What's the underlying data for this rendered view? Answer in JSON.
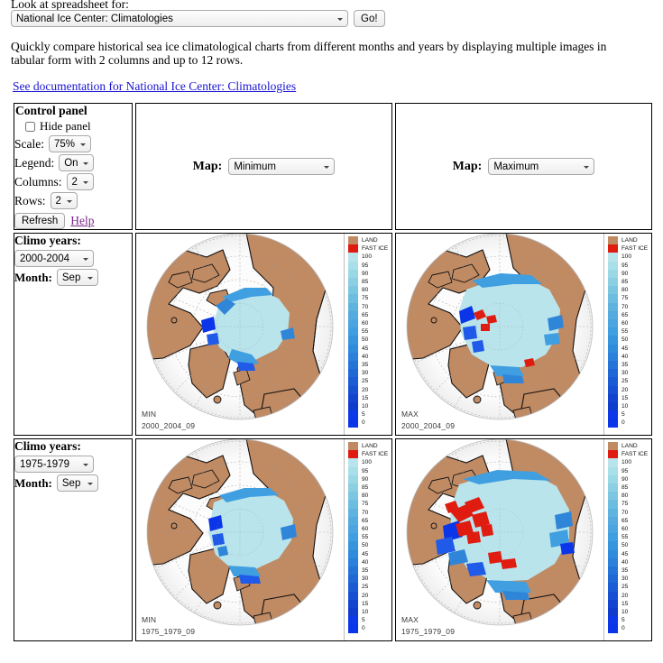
{
  "header": {
    "spreadsheet_label": "Look at spreadsheet for:",
    "dataset_selected": "National Ice Center: Climatologies",
    "go_label": "Go!",
    "description": "Quickly compare historical sea ice climatological charts from different months and years by displaying multiple images in tabular form with 2 columns and up to 12 rows.",
    "doc_link": "See documentation for National Ice Center: Climatologies"
  },
  "control_panel": {
    "title": "Control panel",
    "hide_panel_label": "Hide panel",
    "hide_panel_checked": false,
    "scale_label": "Scale:",
    "scale_value": "75%",
    "legend_label": "Legend:",
    "legend_value": "On",
    "columns_label": "Columns:",
    "columns_value": "2",
    "rows_label": "Rows:",
    "rows_value": "2",
    "refresh_label": "Refresh",
    "help_label": "Help"
  },
  "columns": [
    {
      "map_label": "Map:",
      "map_value": "Minimum"
    },
    {
      "map_label": "Map:",
      "map_value": "Maximum"
    }
  ],
  "rows": [
    {
      "climo_years_label": "Climo years:",
      "climo_years_value": "2000-2004",
      "month_label": "Month:",
      "month_value": "Sep",
      "cells": [
        {
          "tag_type": "MIN",
          "tag_id": "2000_2004_09"
        },
        {
          "tag_type": "MAX",
          "tag_id": "2000_2004_09"
        }
      ]
    },
    {
      "climo_years_label": "Climo years:",
      "climo_years_value": "1975-1979",
      "month_label": "Month:",
      "month_value": "Sep",
      "cells": [
        {
          "tag_type": "MIN",
          "tag_id": "1975_1979_09"
        },
        {
          "tag_type": "MAX",
          "tag_id": "1975_1979_09"
        }
      ]
    }
  ],
  "legend": {
    "land_label": "LAND",
    "fast_ice_label": "FAST ICE",
    "ticks": [
      "100",
      "95",
      "90",
      "85",
      "80",
      "75",
      "70",
      "65",
      "60",
      "55",
      "50",
      "45",
      "40",
      "35",
      "30",
      "25",
      "20",
      "15",
      "10",
      "5",
      "0"
    ]
  },
  "colors": {
    "land": "#c08a63",
    "fast_ice": "#e01b10",
    "ice_high": "#b9e4ec",
    "ice_mid": "#3f9fe0",
    "ice_low": "#0b35e8",
    "ocean": "#ffffff",
    "link": "#1a14d0",
    "visited_link": "#7a2a8a",
    "table_border": "#000000"
  }
}
